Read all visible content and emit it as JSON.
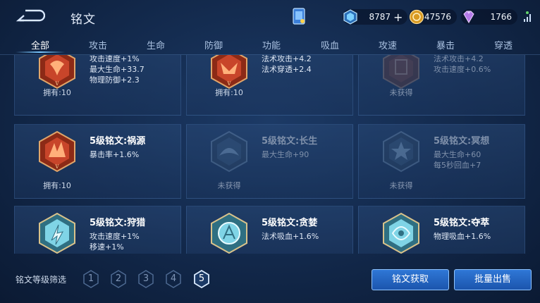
{
  "header": {
    "title": "铭文",
    "resources": {
      "gem": "8787",
      "gold": "47576",
      "diamond": "1766"
    }
  },
  "tabs": [
    {
      "label": "全部",
      "active": true
    },
    {
      "label": "攻击"
    },
    {
      "label": "生命"
    },
    {
      "label": "防御"
    },
    {
      "label": "功能"
    },
    {
      "label": "吸血"
    },
    {
      "label": "攻速"
    },
    {
      "label": "暴击"
    },
    {
      "label": "穿透"
    }
  ],
  "inscriptions": [
    {
      "name": "",
      "stats": [
        "攻击速度+1%",
        "最大生命+33.7",
        "物理防御+2.3"
      ],
      "owned": "拥有:10",
      "color": "red",
      "obtained": true
    },
    {
      "name": "",
      "stats": [
        "法术攻击+4.2",
        "法术穿透+2.4"
      ],
      "owned": "拥有:10",
      "color": "red",
      "obtained": true
    },
    {
      "name": "",
      "stats": [
        "法术攻击+4.2",
        "攻击速度+0.6%"
      ],
      "owned": "未获得",
      "color": "red",
      "obtained": false
    },
    {
      "name": "5级铭文:祸源",
      "stats": [
        "暴击率+1.6%"
      ],
      "owned": "拥有:10",
      "color": "red",
      "obtained": true
    },
    {
      "name": "5级铭文:长生",
      "stats": [
        "最大生命+90"
      ],
      "owned": "未获得",
      "color": "blue",
      "obtained": false
    },
    {
      "name": "5级铭文:冥想",
      "stats": [
        "最大生命+60",
        "每5秒回血+7"
      ],
      "owned": "未获得",
      "color": "blue",
      "obtained": false
    },
    {
      "name": "5级铭文:狩猎",
      "stats": [
        "攻击速度+1%",
        "移速+1%"
      ],
      "owned": "",
      "color": "cyan",
      "obtained": true
    },
    {
      "name": "5级铭文:贪婪",
      "stats": [
        "法术吸血+1.6%"
      ],
      "owned": "",
      "color": "cyan",
      "obtained": true
    },
    {
      "name": "5级铭文:夺萃",
      "stats": [
        "物理吸血+1.6%"
      ],
      "owned": "",
      "color": "cyan",
      "obtained": true
    }
  ],
  "footer": {
    "filter_label": "铭文等级筛选",
    "levels": [
      "1",
      "2",
      "3",
      "4",
      "5"
    ],
    "active_level": "5",
    "obtain_button": "铭文获取",
    "sell_button": "批量出售"
  },
  "colors": {
    "red": "#c8452a",
    "blue": "#4a6c92",
    "cyan": "#7fd4e6",
    "accent": "#2f77d6"
  }
}
